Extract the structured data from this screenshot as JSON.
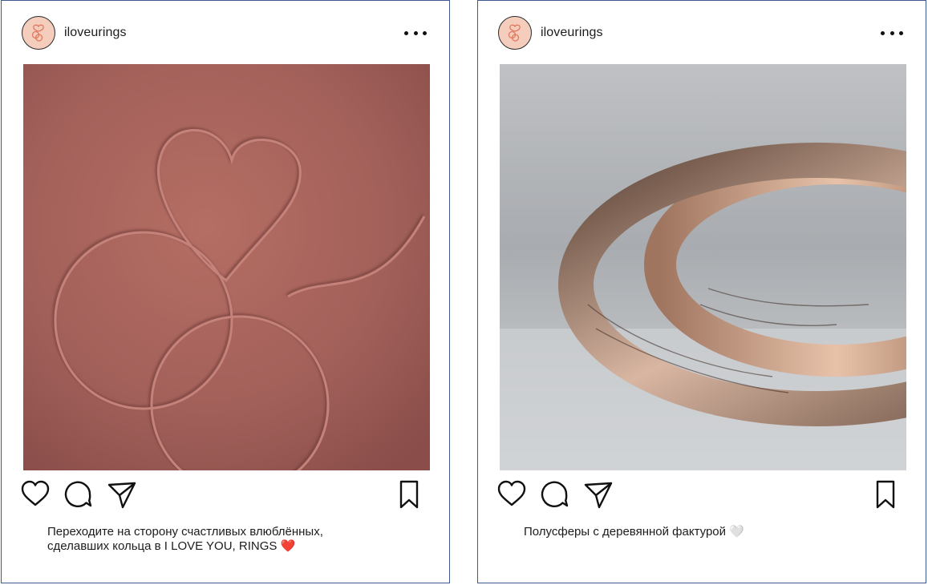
{
  "posts": [
    {
      "username": "iloveurings",
      "image_icon": "embossed-logo-velvet",
      "caption_line1": "Переходите на сторону счастливых влюблённых,",
      "caption_line2": "сделавших кольца в I LOVE YOU, RINGS",
      "caption_emoji": "❤️"
    },
    {
      "username": "iloveurings",
      "image_icon": "textured-rings-photo",
      "caption_line1": "Полусферы с деревянной фактурой",
      "caption_emoji": "🤍"
    }
  ],
  "colors": {
    "frame": "#3d5a8e",
    "avatar_bg": "#f4cdbd",
    "logo_accent": "#e07a5f",
    "velvet": "#a56259",
    "ring_rose": "#c9977d"
  },
  "icons": [
    "more-icon",
    "heart-icon",
    "comment-icon",
    "share-icon",
    "bookmark-icon"
  ]
}
